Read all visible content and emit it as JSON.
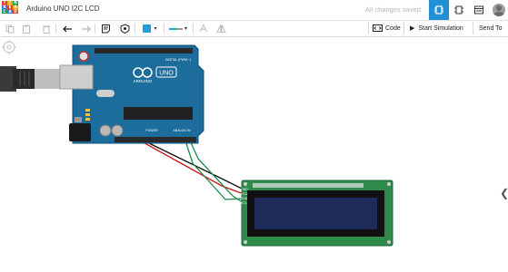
{
  "app": {
    "logo_letters": [
      "T",
      "I",
      "N",
      "K",
      "E",
      "R",
      "C",
      "A",
      "D"
    ],
    "logo_colors": [
      "#e8412a",
      "#f2a31b",
      "#1fa34a",
      "#2d7bd4",
      "#e8412a",
      "#f2a31b",
      "#1fa34a",
      "#2d7bd4",
      "#e8412a"
    ],
    "title": "Arduino UNO I2C LCD",
    "save_status": "All changes saved"
  },
  "toolbar": {
    "code_label": "Code",
    "start_label": "Start Simulation",
    "send_label": "Send To",
    "fill_color": "#18a3d6"
  },
  "board": {
    "brand": "ARDUINO",
    "model": "UNO",
    "digital_label": "DIGITAL (PWM ~)",
    "power_label": "POWER",
    "analog_label": "ANALOG IN",
    "color": "#1c6c9c"
  },
  "lcd": {
    "pin_labels": [
      "GND",
      "VCC",
      "SDA",
      "SCL"
    ],
    "pcb_color": "#2e8b4b",
    "screen_color": "#1e2a5a"
  }
}
